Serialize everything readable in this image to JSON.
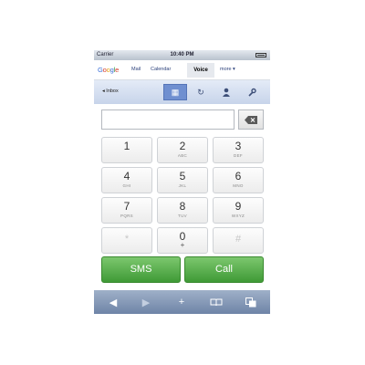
{
  "status": {
    "carrier": "Carrier",
    "time": "10:40 PM"
  },
  "nav": {
    "logo": [
      "G",
      "o",
      "o",
      "g",
      "l",
      "e"
    ],
    "links": {
      "mail": "Mail",
      "calendar": "Calendar",
      "voice": "Voice",
      "more": "more ▾"
    }
  },
  "toolbar": {
    "inbox": "◂  Inbox",
    "icons": [
      "dialpad-icon",
      "refresh-icon",
      "contacts-icon",
      "settings-icon"
    ],
    "active": "dialpad-icon"
  },
  "dialer": {
    "number": "",
    "backspace_icon": "backspace-icon"
  },
  "keypad": [
    {
      "digit": "1",
      "letters": ""
    },
    {
      "digit": "2",
      "letters": "ABC"
    },
    {
      "digit": "3",
      "letters": "DEF"
    },
    {
      "digit": "4",
      "letters": "GHI"
    },
    {
      "digit": "5",
      "letters": "JKL"
    },
    {
      "digit": "6",
      "letters": "MNO"
    },
    {
      "digit": "7",
      "letters": "PQRS"
    },
    {
      "digit": "8",
      "letters": "TUV"
    },
    {
      "digit": "9",
      "letters": "WXYZ"
    },
    {
      "digit": "*",
      "letters": ""
    },
    {
      "digit": "0",
      "letters": "+"
    },
    {
      "digit": "#",
      "letters": ""
    }
  ],
  "actions": {
    "sms": "SMS",
    "call": "Call"
  },
  "browser_bar": {
    "back": "◀",
    "forward": "▶",
    "add": "+",
    "bookmarks": "📖",
    "pages": "⧉"
  },
  "colors": {
    "action_green": "#4fad43",
    "toolbar_active": "#6f8fd0"
  }
}
